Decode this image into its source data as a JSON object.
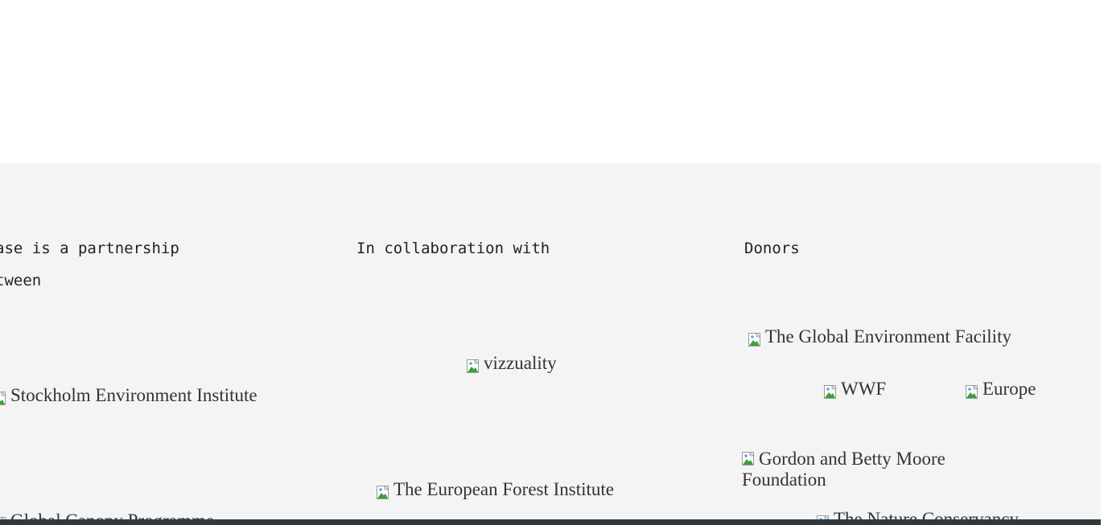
{
  "partners": {
    "col1_heading_line1": "ase is a partnership",
    "col1_heading_line2": "tween",
    "col2_heading": "In collaboration with",
    "col3_heading": "Donors",
    "col1_logos": [
      {
        "alt": "Stockholm Environment Institute"
      },
      {
        "alt": "Global Canopy Programme"
      }
    ],
    "col2_logos": [
      {
        "alt": "vizzuality"
      },
      {
        "alt": "The European Forest Institute"
      }
    ],
    "col3_logos": [
      {
        "alt": "The Global Environment Facility"
      },
      {
        "alt": "WWF"
      },
      {
        "alt": "Europe"
      },
      {
        "alt": "Gordon and Betty Moore Foundation"
      },
      {
        "alt": "The Nature Conservancy"
      }
    ]
  },
  "icons": {
    "broken_image": "broken-image-icon"
  },
  "colors": {
    "section_background": "#f4f4f4",
    "footer_bar": "#2f3a3f",
    "text": "#222222"
  }
}
